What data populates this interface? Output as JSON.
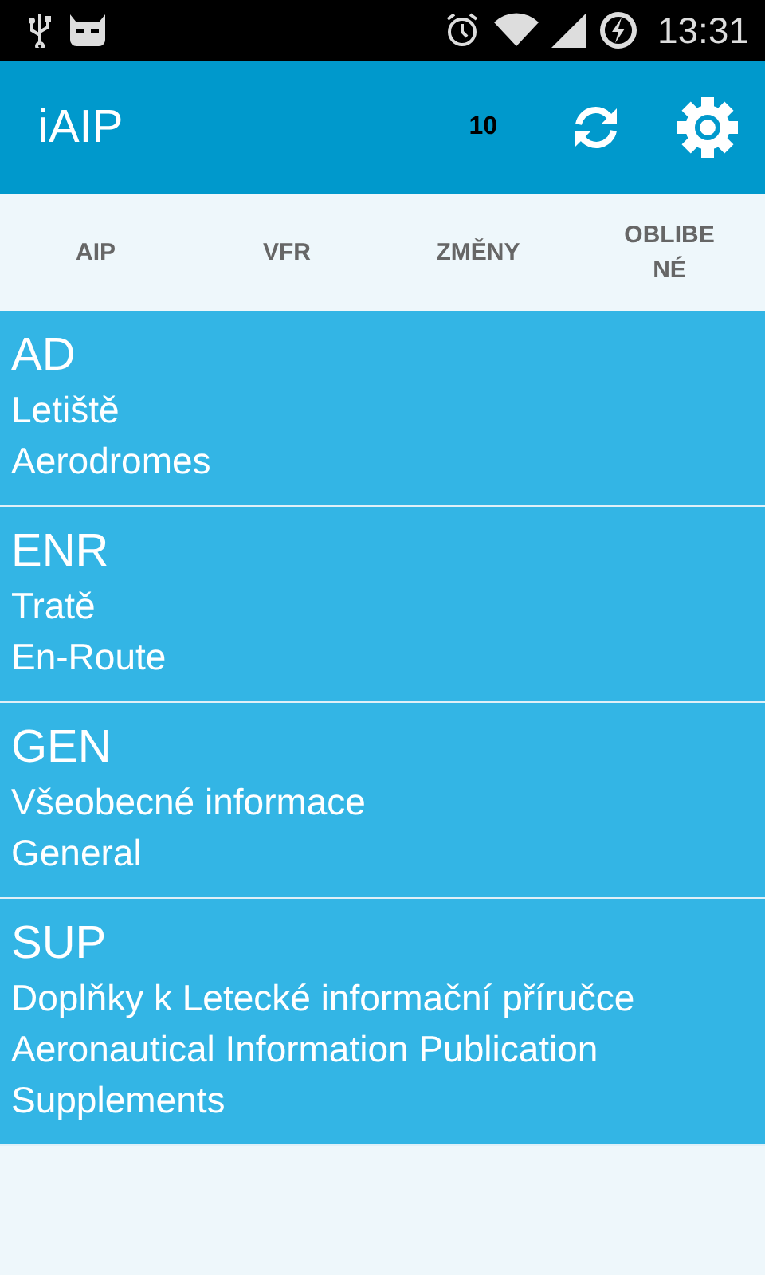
{
  "status_bar": {
    "time": "13:31"
  },
  "app_bar": {
    "title": "iAIP",
    "count": "10"
  },
  "tabs": [
    {
      "label": "AIP"
    },
    {
      "label": "VFR"
    },
    {
      "label": "ZMĚNY"
    },
    {
      "label": "OBLIBENÉ"
    }
  ],
  "sections": [
    {
      "code": "AD",
      "lines": [
        "Letiště",
        "Aerodromes"
      ]
    },
    {
      "code": "ENR",
      "lines": [
        "Tratě",
        "En-Route"
      ]
    },
    {
      "code": "GEN",
      "lines": [
        "Všeobecné informace",
        "General"
      ]
    },
    {
      "code": "SUP",
      "lines": [
        "Doplňky k Letecké informační příručce",
        "Aeronautical Information Publication Supplements"
      ]
    }
  ]
}
